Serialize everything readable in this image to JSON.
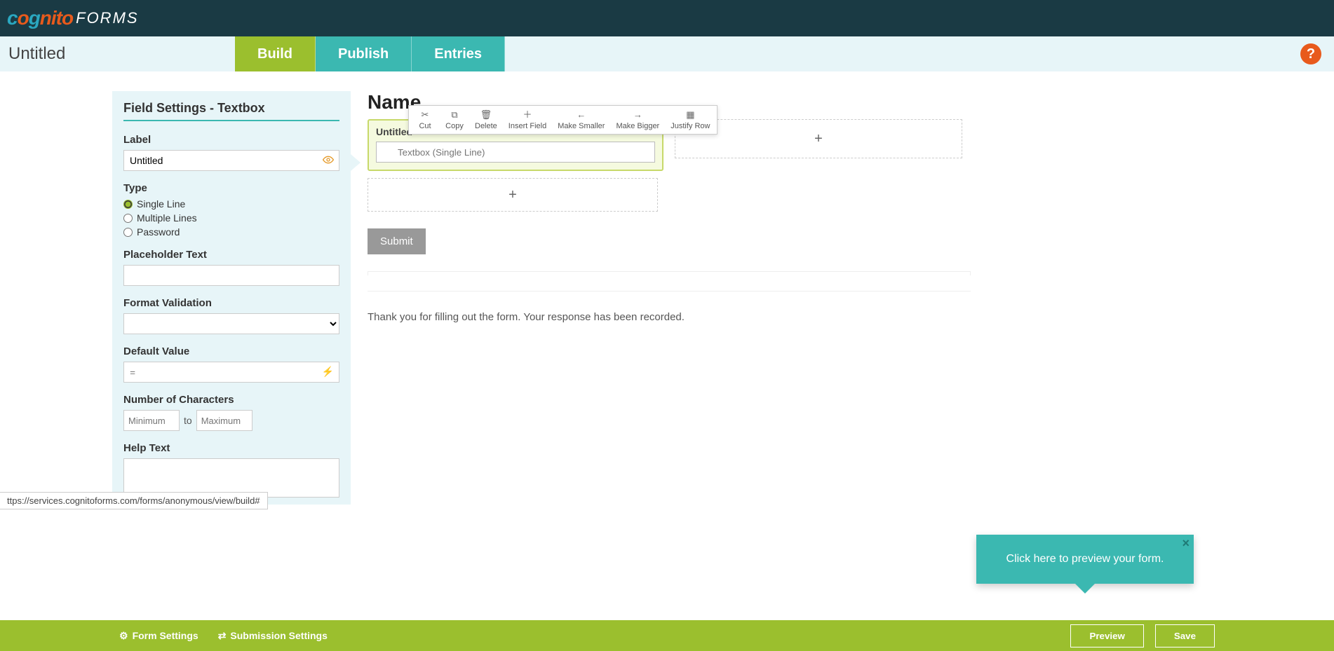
{
  "logo": {
    "cognito": "cognito",
    "forms": "FORMS"
  },
  "nav": {
    "title": "Untitled",
    "tabs": {
      "build": "Build",
      "publish": "Publish",
      "entries": "Entries"
    },
    "help": "?"
  },
  "sidebar": {
    "title": "Field Settings - Textbox",
    "label_heading": "Label",
    "label_value": "Untitled",
    "type_heading": "Type",
    "type_options": {
      "single": "Single Line",
      "multiple": "Multiple Lines",
      "password": "Password"
    },
    "placeholder_heading": "Placeholder Text",
    "format_heading": "Format Validation",
    "default_heading": "Default Value",
    "default_placeholder": "=",
    "numchars_heading": "Number of Characters",
    "min_ph": "Minimum",
    "to": "to",
    "max_ph": "Maximum",
    "help_heading": "Help Text"
  },
  "toolbar": {
    "cut": "Cut",
    "copy": "Copy",
    "delete": "Delete",
    "insert": "Insert Field",
    "smaller": "Make Smaller",
    "bigger": "Make Bigger",
    "justify": "Justify Row"
  },
  "canvas": {
    "form_title": "Name",
    "field_label": "Untitled",
    "field_placeholder": "Textbox (Single Line)",
    "add": "+",
    "submit": "Submit",
    "confirmation": "Thank you for filling out the form. Your response has been recorded."
  },
  "tooltip": {
    "text": "Click here to preview your form.",
    "close": "×"
  },
  "status_url": "ttps://services.cognitoforms.com/forms/anonymous/view/build#",
  "footer": {
    "form_settings": "Form Settings",
    "submission_settings": "Submission Settings",
    "preview": "Preview",
    "save": "Save"
  }
}
